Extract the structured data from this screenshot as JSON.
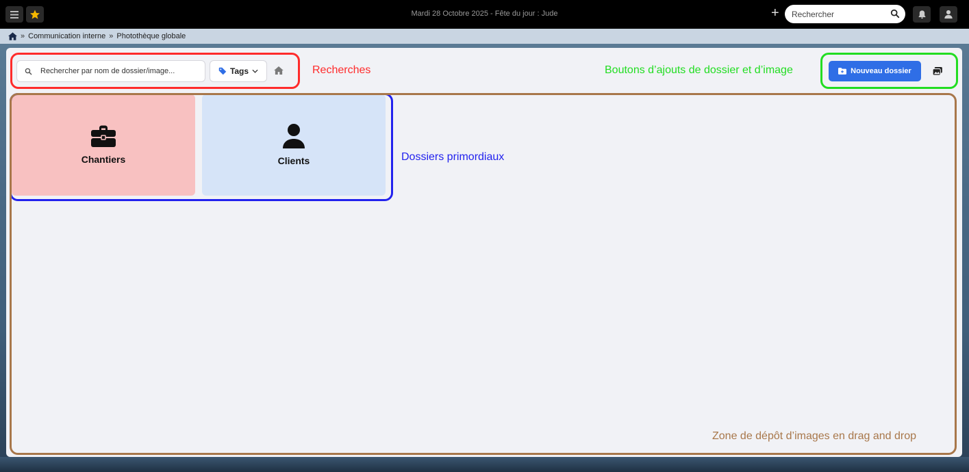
{
  "topbar": {
    "date_text": "Mardi 28 Octobre 2025 - Fête du jour : Jude",
    "search_placeholder": "Rechercher",
    "icons": [
      "menu-icon",
      "star-icon",
      "plus-icon",
      "search-icon",
      "bell-icon",
      "user-icon"
    ]
  },
  "breadcrumb": {
    "items": [
      "Communication interne",
      "Photothèque globale"
    ],
    "separator": "»"
  },
  "toolbar": {
    "search_placeholder": "Rechercher par nom de dossier/image...",
    "tags_label": "Tags",
    "new_folder_label": "Nouveau dossier"
  },
  "folders": [
    {
      "name": "Chantiers",
      "icon": "briefcase-icon",
      "color": "#f8c1c1"
    },
    {
      "name": "Clients",
      "icon": "user-icon",
      "color": "#d6e4f8"
    }
  ],
  "annotations": {
    "search": {
      "label": "Recherches",
      "color": "#ff2b2b"
    },
    "add_buttons": {
      "label": "Boutons d’ajouts de dossier et d’image",
      "color": "#22dd22"
    },
    "folders": {
      "label": "Dossiers primordiaux",
      "color": "#2222ee"
    },
    "dropzone": {
      "label": "Zone de dépôt d’images en drag and drop",
      "color": "#a8774a"
    }
  },
  "colors": {
    "accent": "#2f6ee6",
    "topbar": "#000000",
    "star": "#f5b800",
    "tag_icon": "#2f6ee6"
  }
}
